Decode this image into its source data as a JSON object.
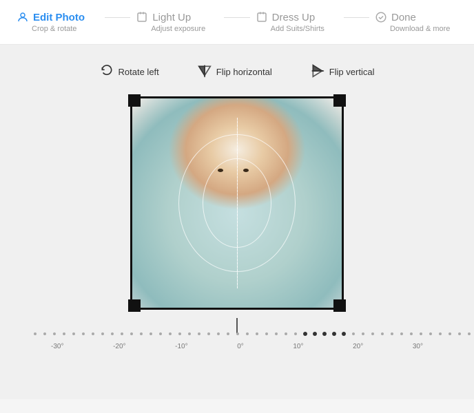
{
  "steps": [
    {
      "id": "edit-photo",
      "title": "Edit Photo",
      "subtitle": "Crop & rotate",
      "active": true,
      "icon": "person-icon"
    },
    {
      "id": "light-up",
      "title": "Light Up",
      "subtitle": "Adjust exposure",
      "active": false,
      "icon": "sun-icon"
    },
    {
      "id": "dress-up",
      "title": "Dress Up",
      "subtitle": "Add Suits/Shirts",
      "active": false,
      "icon": "shirt-icon"
    },
    {
      "id": "done",
      "title": "Done",
      "subtitle": "Download & more",
      "active": false,
      "icon": "check-icon"
    }
  ],
  "toolbar": {
    "buttons": [
      {
        "id": "rotate-left",
        "label": "Rotate left",
        "icon": "rotate-left-icon"
      },
      {
        "id": "flip-horizontal",
        "label": "Flip horizontal",
        "icon": "flip-h-icon"
      },
      {
        "id": "flip-vertical",
        "label": "Flip vertical",
        "icon": "flip-v-icon"
      }
    ]
  },
  "ruler": {
    "labels": [
      "-30°",
      "-20°",
      "-10°",
      "0°",
      "10°",
      "20°",
      "30°"
    ],
    "current_value": "0°"
  },
  "accent_color": "#2b8ef0"
}
